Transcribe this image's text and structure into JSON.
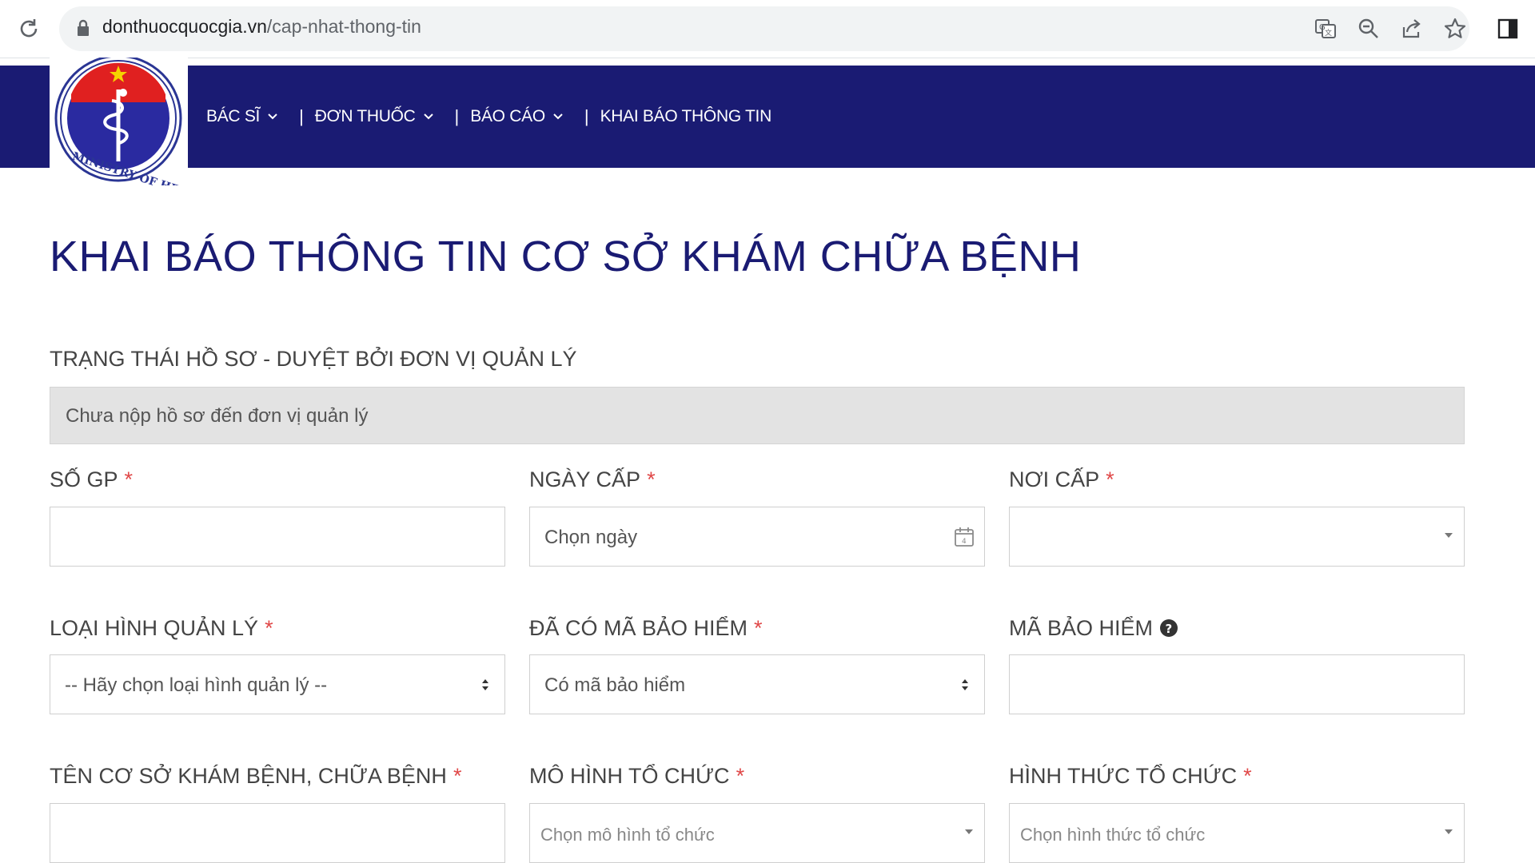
{
  "browser": {
    "url_domain": "donthuocquocgia.vn",
    "url_path": "/cap-nhat-thong-tin",
    "icons": [
      "reload-icon",
      "lock-icon",
      "translate-icon",
      "zoom-icon",
      "share-icon",
      "bookmark-star-icon",
      "side-panel-icon"
    ]
  },
  "header": {
    "logo_icon": "ministry-of-health-logo",
    "nav": [
      {
        "label": "BÁC SĨ"
      },
      {
        "label": "ĐƠN THUỐC"
      },
      {
        "label": "BÁO CÁO"
      },
      {
        "label": "KHAI BÁO THÔNG TIN"
      }
    ],
    "separator": "|"
  },
  "page": {
    "title": "KHAI BÁO THÔNG TIN CƠ SỞ KHÁM CHỮA BỆNH",
    "status_label": "TRẠNG THÁI HỒ SƠ - DUYỆT BỞI ĐƠN VỊ QUẢN LÝ",
    "status_value": "Chưa nộp hồ sơ đến đơn vị quản lý"
  },
  "form": {
    "required_mark": "*",
    "so_gp": {
      "label": "SỐ GP",
      "value": ""
    },
    "ngay_cap": {
      "label": "NGÀY CẤP",
      "placeholder": "Chọn ngày"
    },
    "noi_cap": {
      "label": "NƠI CẤP",
      "value": ""
    },
    "loai_hinh": {
      "label": "LOẠI HÌNH QUẢN LÝ",
      "value": "-- Hãy chọn loại hình quản lý --"
    },
    "da_co_ma": {
      "label": "ĐÃ CÓ MÃ BẢO HIỂM",
      "value": "Có mã bảo hiểm"
    },
    "ma_bao_hiem": {
      "label": "MÃ BẢO HIỂM",
      "value": ""
    },
    "ten_co_so": {
      "label": "TÊN CƠ SỞ KHÁM BỆNH, CHỮA BỆNH",
      "value": ""
    },
    "mo_hinh": {
      "label": "MÔ HÌNH TỔ CHỨC",
      "placeholder": "Chọn mô hình tổ chức"
    },
    "hinh_thuc": {
      "label": "HÌNH THỨC TỔ CHỨC",
      "placeholder": "Chọn hình thức tổ chức"
    }
  },
  "colors": {
    "navbar": "#1a1b73",
    "title": "#1a1b73",
    "required": "#e04848",
    "status_bg": "#e3e3e3"
  }
}
